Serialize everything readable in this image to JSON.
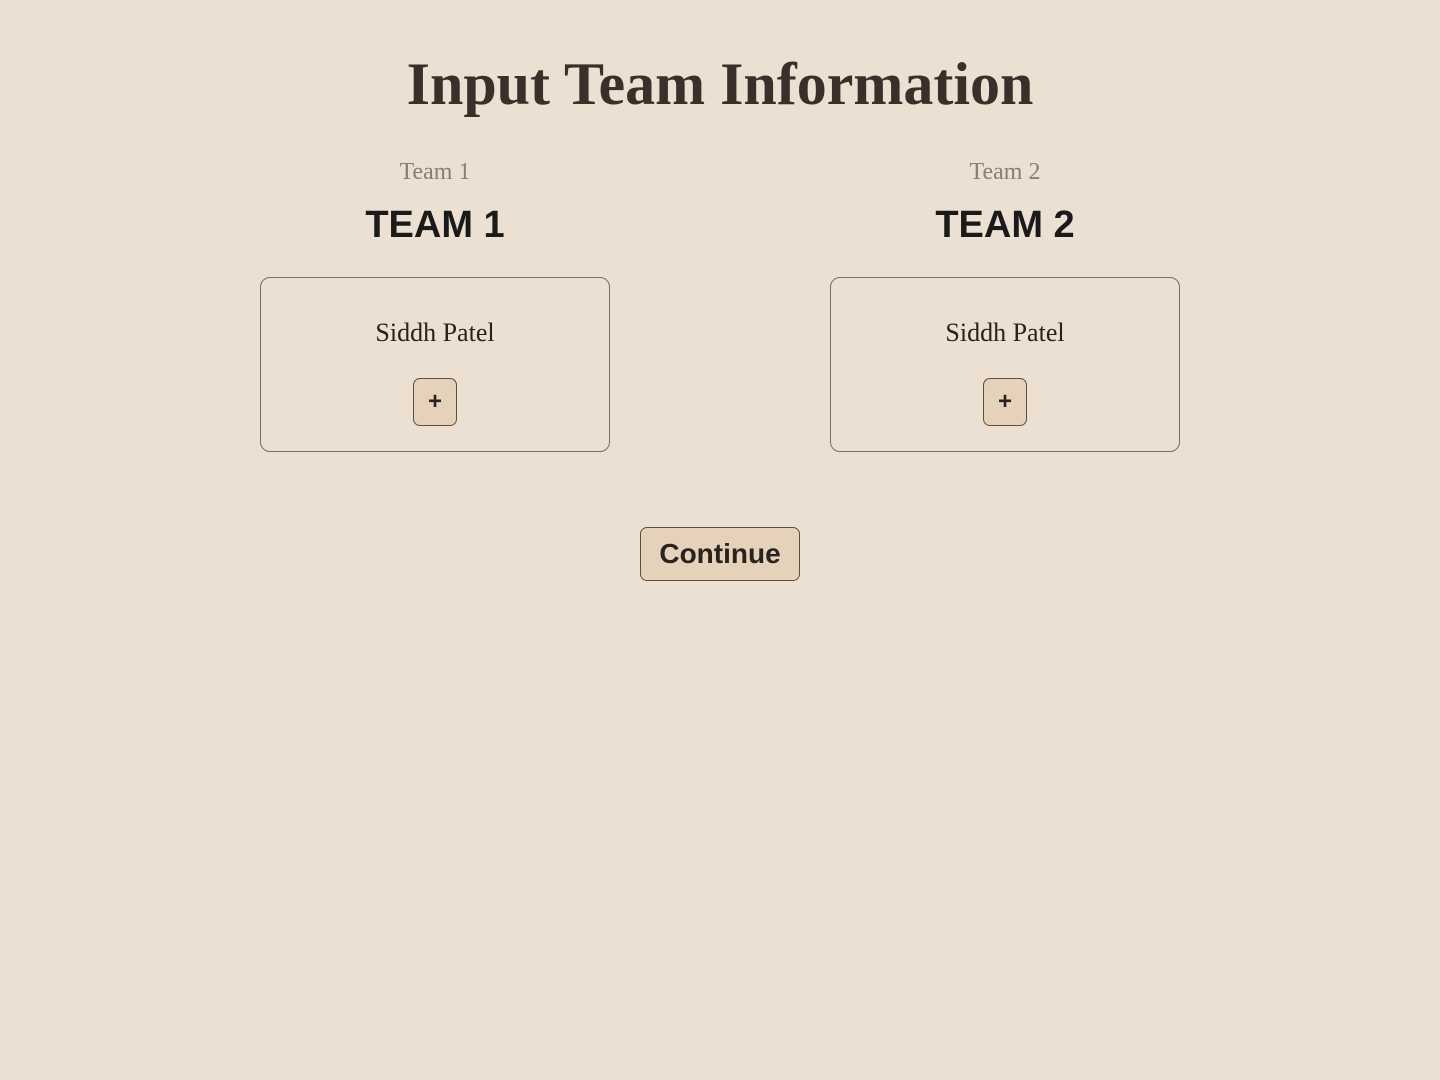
{
  "title": "Input Team Information",
  "teams": [
    {
      "label": "Team 1",
      "name": "TEAM 1",
      "players": [
        "Siddh Patel"
      ],
      "add_label": "+"
    },
    {
      "label": "Team 2",
      "name": "TEAM 2",
      "players": [
        "Siddh Patel"
      ],
      "add_label": "+"
    }
  ],
  "continue_label": "Continue"
}
